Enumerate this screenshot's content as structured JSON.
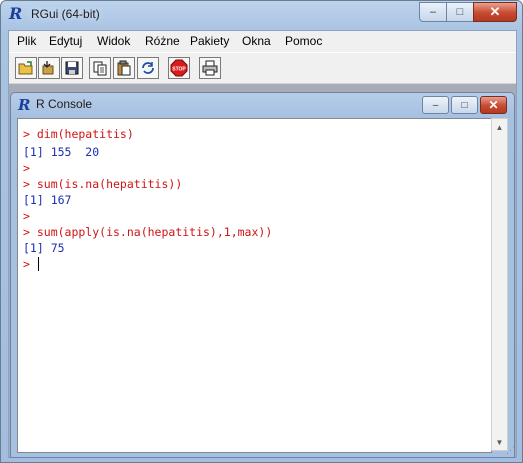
{
  "app": {
    "title": "RGui (64-bit)",
    "icon": "R-logo-icon"
  },
  "window_controls": {
    "minimize": "–",
    "maximize": "□",
    "close": "✕"
  },
  "menu": [
    "Plik",
    "Edytuj",
    "Widok",
    "Różne",
    "Pakiety",
    "Okna",
    "Pomoc"
  ],
  "toolbar": {
    "buttons": [
      "open-script-icon",
      "load-workspace-icon",
      "save-workspace-icon",
      "copy-icon",
      "paste-icon",
      "copy-paste-icon",
      "stop-icon",
      "print-icon"
    ],
    "stop_label": "STOP"
  },
  "console": {
    "title": "R Console",
    "lines": [
      {
        "type": "input",
        "text": "> dim(hepatitis)"
      },
      {
        "type": "output",
        "text": "[1] 155  20"
      },
      {
        "type": "input",
        "text": ">"
      },
      {
        "type": "input",
        "text": "> sum(is.na(hepatitis))"
      },
      {
        "type": "output",
        "text": "[1] 167"
      },
      {
        "type": "input",
        "text": ">"
      },
      {
        "type": "input",
        "text": "> sum(apply(is.na(hepatitis),1,max))"
      },
      {
        "type": "output",
        "text": "[1] 75"
      },
      {
        "type": "input",
        "text": "> "
      }
    ]
  },
  "colors": {
    "prompt": "#d01515",
    "output": "#1a2fb0"
  }
}
